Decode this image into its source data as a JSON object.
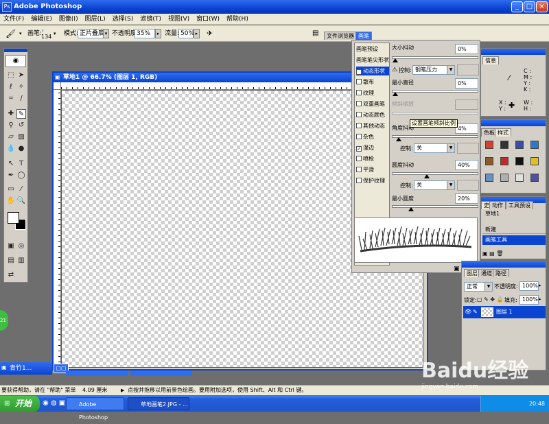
{
  "title": {
    "text": "Adobe Photoshop",
    "icon": "photoshop-icon"
  },
  "menu": [
    "文件(F)",
    "编辑(E)",
    "图像(I)",
    "图层(L)",
    "选择(S)",
    "滤镜(T)",
    "视图(V)",
    "窗口(W)",
    "帮助(H)"
  ],
  "options": {
    "brush_label": "画笔:",
    "brush_size": "134",
    "mode_label": "模式:",
    "mode_value": "正片叠底",
    "opacity_label": "不透明度:",
    "opacity_value": "35%",
    "flow_label": "流量:",
    "flow_value": "50%",
    "tab_file_browser": "文件浏览器",
    "tab_brushes": "画笔"
  },
  "document": {
    "title": "草地1 @ 66.7% (图层 1, RGB)"
  },
  "brush_panel": {
    "list": [
      {
        "label": "画笔预设",
        "checkbox": false,
        "checked": false,
        "selected": false
      },
      {
        "label": "画笔笔尖形状",
        "checkbox": false,
        "checked": false,
        "selected": false
      },
      {
        "label": "动态形状",
        "checkbox": true,
        "checked": true,
        "selected": true
      },
      {
        "label": "散布",
        "checkbox": true,
        "checked": false,
        "selected": false
      },
      {
        "label": "纹理",
        "checkbox": true,
        "checked": false,
        "selected": false
      },
      {
        "label": "双重画笔",
        "checkbox": true,
        "checked": false,
        "selected": false
      },
      {
        "label": "动态颜色",
        "checkbox": true,
        "checked": false,
        "selected": false
      },
      {
        "label": "其他动态",
        "checkbox": true,
        "checked": false,
        "selected": false
      },
      {
        "label": "杂色",
        "checkbox": true,
        "checked": false,
        "selected": false
      },
      {
        "label": "湿边",
        "checkbox": true,
        "checked": true,
        "selected": false
      },
      {
        "label": "喷枪",
        "checkbox": true,
        "checked": false,
        "selected": false
      },
      {
        "label": "平滑",
        "checkbox": true,
        "checked": false,
        "selected": false
      },
      {
        "label": "保护纹理",
        "checkbox": true,
        "checked": false,
        "selected": false
      }
    ],
    "size_jitter_label": "大小抖动",
    "size_jitter": "0%",
    "control_label": "控制:",
    "control_value1": "钢笔压力",
    "min_diameter_label": "最小直径",
    "min_diameter": "0%",
    "tilt_scale_label": "倾斜缩放",
    "angle_jitter_label": "角度抖动",
    "angle_jitter": "4%",
    "tooltip": "设置画笔倾斜比例",
    "control_value2": "关",
    "roundness_jitter_label": "圆度抖动",
    "roundness_jitter": "40%",
    "control_value3": "关",
    "min_roundness_label": "最小圆度",
    "min_roundness": "20%",
    "levels": {
      "size_jitter": 0,
      "min_diameter": 0,
      "angle_jitter": 4,
      "roundness_jitter": 40,
      "min_roundness": 20
    }
  },
  "info_panel": {
    "tab": "信息",
    "c": "C :",
    "m": "M :",
    "y": "Y :",
    "k": "K :",
    "x": "X :",
    "y2": "Y :",
    "w": "W :",
    "h": "H :"
  },
  "styles_panel": {
    "tab1": "色板",
    "tab2": "样式",
    "swatches": [
      "#d24030",
      "#333333",
      "#3a4fa0",
      "#2a7ad0",
      "#8a5a2a",
      "#c02a2a",
      "#111111",
      "#e0c020",
      "#6a90c0",
      "#b0b0b0",
      "#e0e0e0",
      "#5050a0"
    ]
  },
  "history_panel": {
    "tab1": "史",
    "tab2": "动作",
    "tab3": "工具预设",
    "doc": "草地1",
    "items": [
      "新建",
      "画笔工具"
    ]
  },
  "layers_panel": {
    "tab1": "图层",
    "tab2": "通道",
    "tab3": "路径",
    "mode": "正常",
    "opacity_label": "不透明度:",
    "opacity": "100%",
    "lock_label": "锁定:",
    "fill_label": "填充:",
    "fill": "100%",
    "layer_name": "图层 1"
  },
  "minimized": [
    {
      "label": "青竹1..."
    }
  ],
  "status": {
    "help": "要获得帮助，请在 \"帮助\" 菜单",
    "size": "4.09 厘米",
    "hint": "点按并拖移以用前景色绘画。要用附加选项，使用 Shift、Alt 和 Ctrl 键。"
  },
  "taskbar": {
    "start": "开始",
    "app1": "Adobe Photoshop",
    "app2": "草地画笔2.JPG - ...",
    "time": "20:48"
  },
  "watermark": {
    "text": "Baidu经验",
    "sub": "jingyan.baidu.com"
  }
}
